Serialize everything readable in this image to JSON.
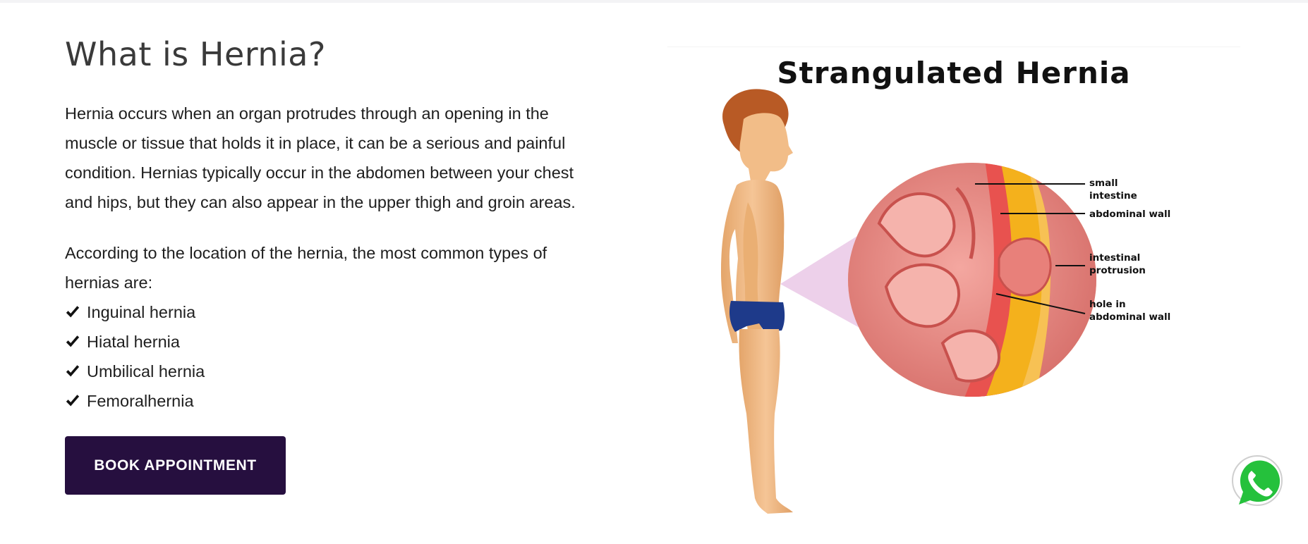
{
  "section": {
    "title": "What is Hernia?",
    "intro": "Hernia occurs when an organ protrudes through an opening in the muscle or tissue that holds it in place, it can be a serious and painful condition. Hernias typically occur in the abdomen between your chest and hips, but they can also appear in the upper thigh and groin areas.",
    "types_intro": "According to the location of the hernia, the most common types of hernias are:",
    "types": [
      "Inguinal hernia",
      "Hiatal hernia",
      "Umbilical hernia",
      "Femoralhernia"
    ],
    "button_label": "BOOK APPOINTMENT"
  },
  "figure": {
    "title": "Strangulated Hernia",
    "labels": {
      "small_intestine_1": "small",
      "small_intestine_2": "intestine",
      "abdominal_wall": "abdominal wall",
      "protrusion_1": "intestinal",
      "protrusion_2": "protrusion",
      "hole_1": "hole in",
      "hole_2": "abdominal wall"
    }
  },
  "icons": {
    "check": "check-icon",
    "whatsapp": "whatsapp-icon"
  },
  "colors": {
    "button_bg": "#260f3f",
    "button_text": "#ffffff",
    "whatsapp_green": "#25c13c"
  }
}
